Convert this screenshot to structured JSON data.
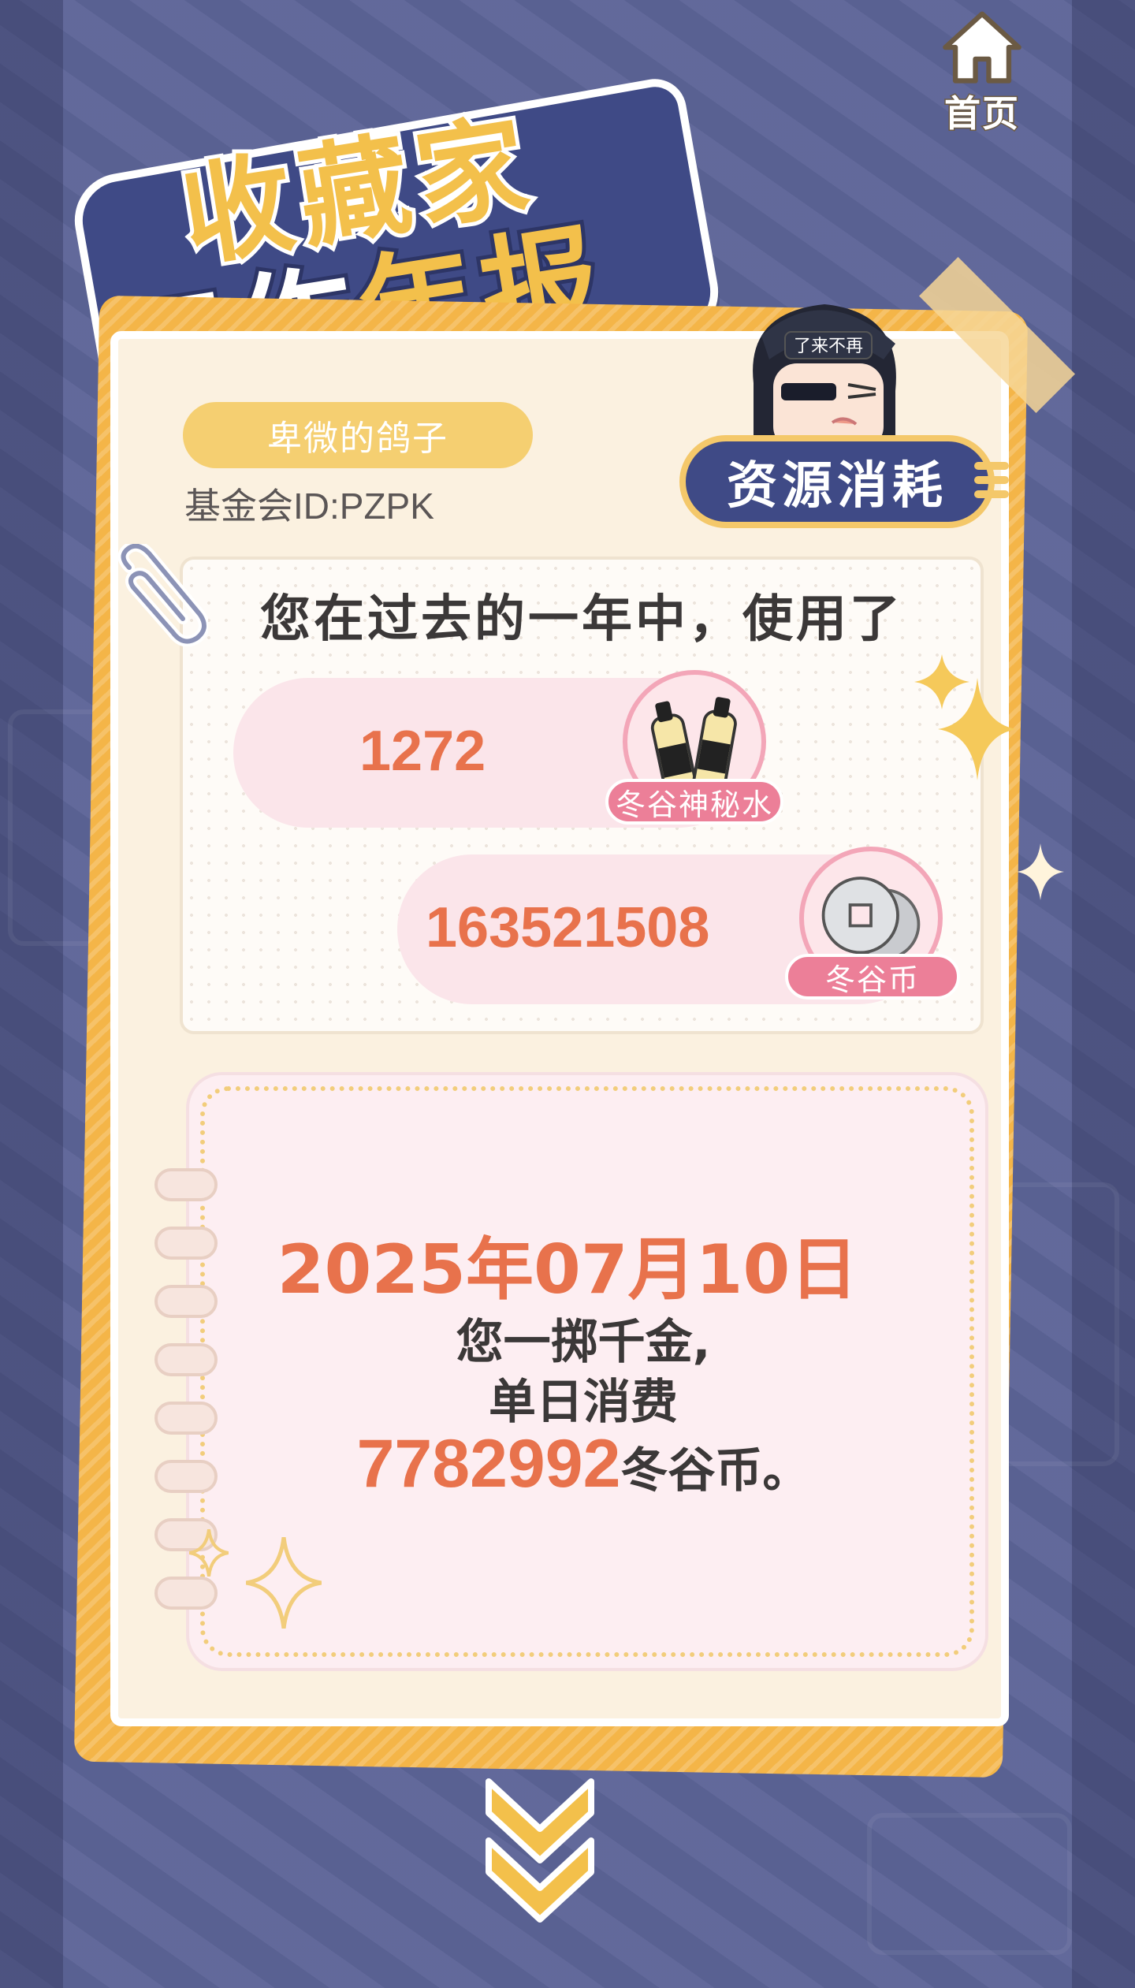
{
  "nav": {
    "home_label": "首页"
  },
  "title": {
    "line1": "收藏家",
    "line2_prefix": "工作",
    "line2_suffix": "年报"
  },
  "profile": {
    "username": "卑微的鸽子",
    "fund_id": "基金会ID:PZPK"
  },
  "mascot": {
    "hat_text": "了来不再"
  },
  "section_badge": "资源消耗",
  "usage": {
    "heading": "您在过去的一年中，使用了",
    "items": [
      {
        "value": "1272",
        "label": "冬谷神秘水",
        "icon": "potion-bottles-icon"
      },
      {
        "value": "163521508",
        "label": "冬谷币",
        "icon": "coins-icon"
      }
    ]
  },
  "highlight": {
    "date": "2025年07月10日",
    "line1": "您一掷千金,",
    "line2": "单日消费",
    "amount": "7782992",
    "unit": "冬谷币。"
  },
  "colors": {
    "accent": "#e8724c",
    "brand_navy": "#3f4a86",
    "gold": "#f4b548",
    "pink": "#ec7f98"
  }
}
